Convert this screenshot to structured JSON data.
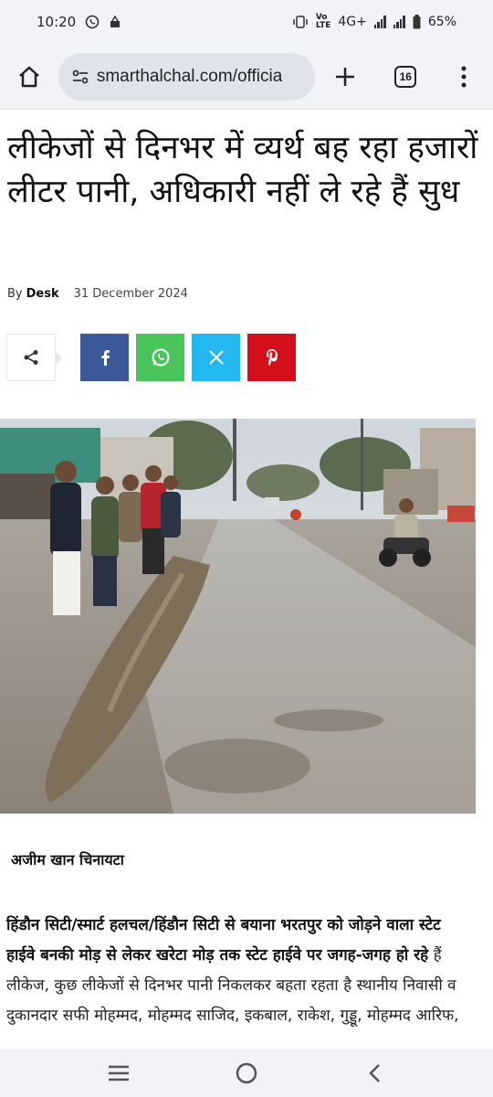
{
  "status": {
    "time": "10:20",
    "network": "4G+",
    "battery": "65%"
  },
  "browser": {
    "url": "smarthalchal.com/officia",
    "tab_count": "16"
  },
  "article": {
    "title": "लीकेजों से दिनभर में व्यर्थ बह रहा हजारों लीटर पानी, अधिकारी नहीं ले रहे हैं सुध",
    "by_label": "By",
    "author": "Desk",
    "date": "31 December 2024",
    "share_buttons": [
      "share-icon",
      "facebook-icon",
      "whatsapp-icon",
      "x-icon",
      "pinterest-icon"
    ],
    "byline": "अजीम खान चिनायटा",
    "body_bold": "हिंडौन सिटी/स्मार्ट हलचल/हिंडौन सिटी से बयाना भरतपुर को जोड़ने वाला स्टेट हाईवे बनकी मोड़ से लेकर खरेटा मोड़ तक स्टेट हाईवे पर जगह-जगह हो रहे",
    "body_rest": " हैं लीकेज, कुछ लीकेजों से दिनभर पानी निकलकर बहता रहता है स्थानीय निवासी व दुकानदार सफी मोहम्मद, मोहम्मद साजिद, इकबाल, राकेश, गुड्डू, मोहम्मद आरिफ,"
  },
  "colors": {
    "facebook": "#3b5998",
    "whatsapp": "#4ac35b",
    "x": "#23b9f0",
    "pinterest": "#d30f1c"
  }
}
